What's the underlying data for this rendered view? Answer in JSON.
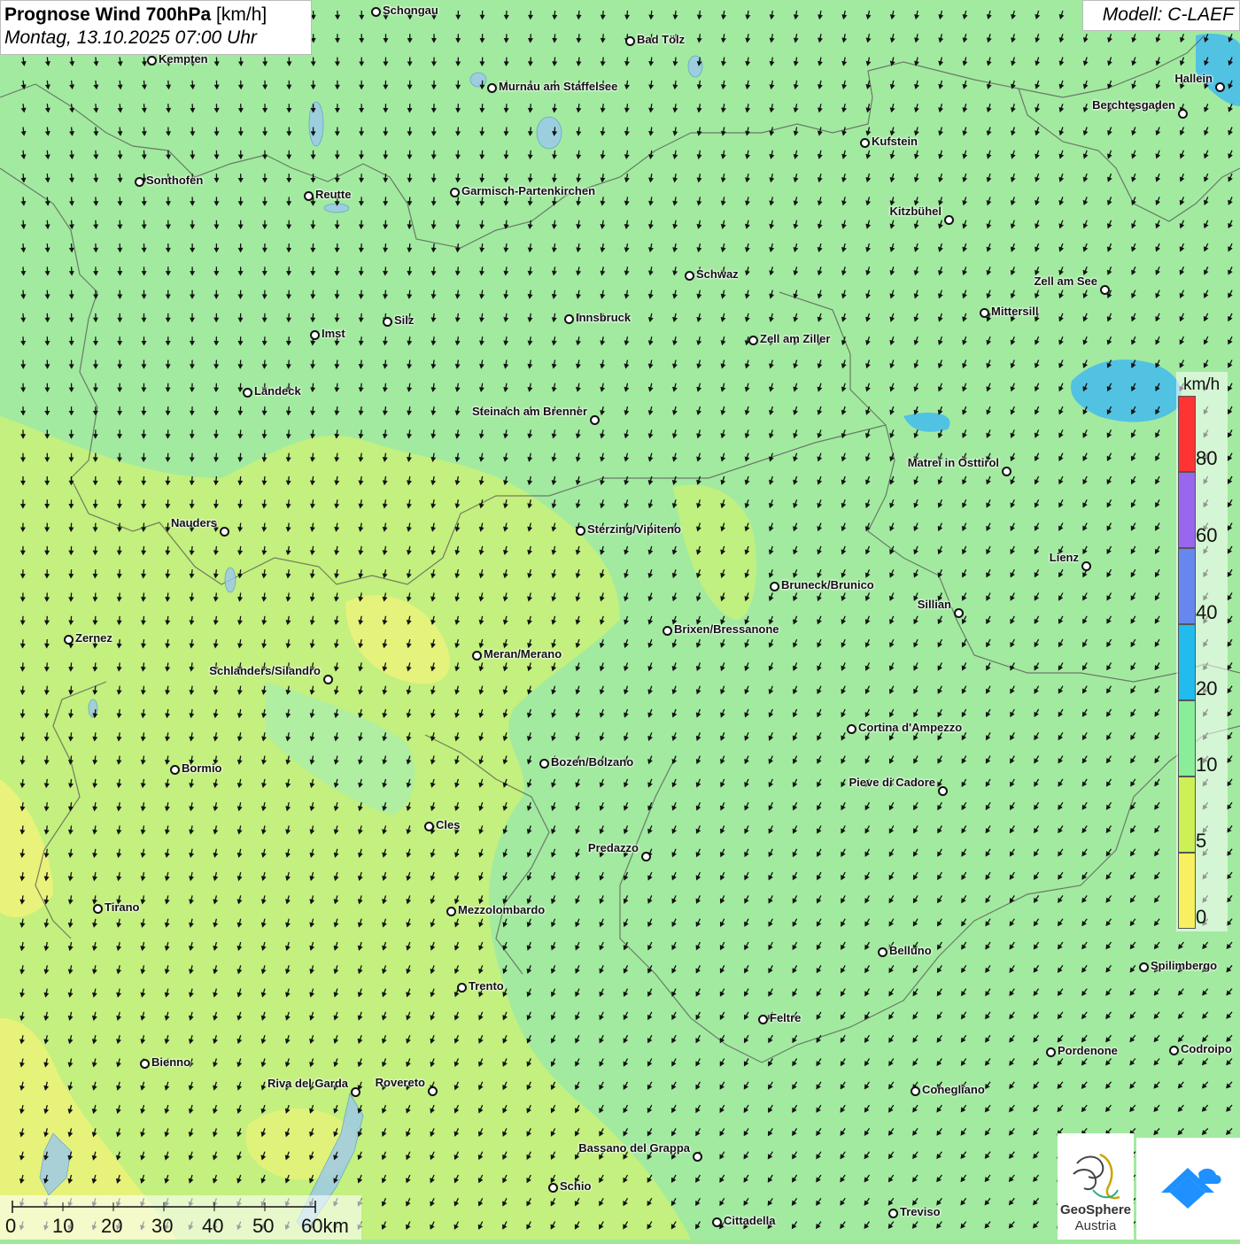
{
  "title": {
    "main": "Prognose Wind 700hPa",
    "unit": "[km/h]",
    "date": "Montag, 13.10.2025 07:00 Uhr"
  },
  "model": "Modell: C-LAEF",
  "legend": {
    "unit": "km/h",
    "labels": [
      "80",
      "60",
      "40",
      "20",
      "10",
      "5",
      "0"
    ],
    "colors": [
      "#ff3333",
      "#9966ee",
      "#6688ee",
      "#22bbee",
      "#88ee99",
      "#ccf055",
      "#f8f060"
    ]
  },
  "scale": {
    "labels": [
      "0",
      "10",
      "20",
      "30",
      "40",
      "50",
      "60km"
    ]
  },
  "logo": {
    "name_line1": "GeoSphere",
    "name_line2": "Austria"
  },
  "cities": [
    "Schongau",
    "Bad Tölz",
    "Kempten",
    "Murnau am Staffelsee",
    "Hallein",
    "Berchtesgaden",
    "Kufstein",
    "Sonthofen",
    "Reutte",
    "Garmisch-Partenkirchen",
    "Kitzbühel",
    "Schwaz",
    "Zell am See",
    "Mittersill",
    "Innsbruck",
    "Silz",
    "Imst",
    "Zell am Ziller",
    "Landeck",
    "Steinach am Brenner",
    "Matrei in Osttirol",
    "Nauders",
    "Sterzing/Vipiteno",
    "Lienz",
    "Bruneck/Brunico",
    "Sillian",
    "Zernez",
    "Brixen/Bressanone",
    "Meran/Merano",
    "Schlanders/Silandro",
    "Cortina d'Ampezzo",
    "Bormio",
    "Bozen/Bolzano",
    "Pieve di Cadore",
    "Cles",
    "Predazzo",
    "Tirano",
    "Mezzolombardo",
    "Belluno",
    "Spilimbergo",
    "Trento",
    "Feltre",
    "Pordenone",
    "Codroipo",
    "Bienno",
    "Riva del Garda",
    "Rovereto",
    "Conegliano",
    "Bassano del Grappa",
    "Schio",
    "Treviso",
    "Cittadella"
  ]
}
